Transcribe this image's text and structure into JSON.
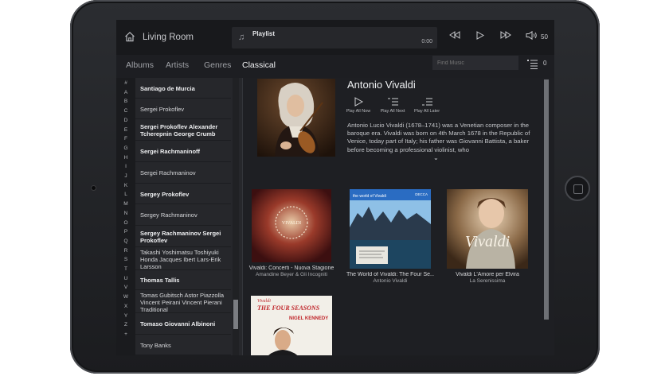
{
  "topbar": {
    "room": "Living Room",
    "now_playing_title": "Playlist",
    "note_glyph": "♫",
    "time": "0:00",
    "volume": "50"
  },
  "tabs": [
    "Albums",
    "Artists",
    "Genres",
    "Classical"
  ],
  "active_tab": "Classical",
  "search": {
    "placeholder": "Find Music"
  },
  "queue_count": "0",
  "alphabet": [
    "#",
    "A",
    "B",
    "C",
    "D",
    "E",
    "F",
    "G",
    "H",
    "I",
    "J",
    "K",
    "L",
    "M",
    "N",
    "O",
    "P",
    "Q",
    "R",
    "S",
    "T",
    "U",
    "V",
    "W",
    "X",
    "Y",
    "Z",
    "+"
  ],
  "artists": [
    {
      "name": "Santiago de Murcia",
      "bold": true
    },
    {
      "name": "Sergei Prokoflev",
      "bold": false
    },
    {
      "name": "Sergei Prokoflev Alexander Tcherepnin George Crumb",
      "bold": true
    },
    {
      "name": "Sergei Rachmaninoff",
      "bold": true
    },
    {
      "name": "Sergei Rachmaninov",
      "bold": false
    },
    {
      "name": "Sergey Prokoflev",
      "bold": true
    },
    {
      "name": "Sergey Rachmaninov",
      "bold": false
    },
    {
      "name": "Sergey Rachmaninov Sergei Prokoflev",
      "bold": true
    },
    {
      "name": "Takashi Yoshimatsu Toshiyuki Honda Jacques Ibert Lars-Erik Larsson",
      "bold": false
    },
    {
      "name": "Thomas Tallis",
      "bold": true
    },
    {
      "name": "Tomas Gubitsch Astor Piazzolla Vincent Peirani Vincent Pierani Traditional",
      "bold": false
    },
    {
      "name": "Tomaso Giovanni Albinoni",
      "bold": true
    },
    {
      "name": "Tony Banks",
      "bold": false
    }
  ],
  "detail": {
    "artist_name": "Antonio Vivaldi",
    "actions": [
      "Play All Now",
      "Play All Next",
      "Play All Later"
    ],
    "bio": "Antonio Lucio Vivaldi (1678–1741) was a Venetian composer in the baroque era. Vivaldi was born on 4th March 1678 in the Republic of Venice, today part of Italy; his father was Giovanni Battista, a baker before becoming a professional violinist, who",
    "expand_glyph": "⌄"
  },
  "albums": [
    {
      "title": "Vivaldi: Concerti - Nuova Stagione",
      "artist": "Amandine Beyer & Gli Incogniti"
    },
    {
      "title": "The World of Vivaldi: The Four Se...",
      "artist": "Antonio Vivaldi"
    },
    {
      "title": "Vivaldi L'Amore per Elvira",
      "artist": "La Serenissima"
    },
    {
      "title": "",
      "artist": ""
    }
  ],
  "album_art_text": {
    "a1_line1": "VIVALDI",
    "a2_label": "the world of Vivaldi",
    "a2_brand": "DECCA",
    "a3_script": "Vivaldi",
    "a4_line1": "Vivaldi",
    "a4_line2": "THE FOUR SEASONS",
    "a4_line3": "NIGEL KENNEDY"
  },
  "colors": {
    "screen_bg": "#1d1e22",
    "panel_bg": "#26272b",
    "text": "#cfd0d3",
    "accent_red": "#c0262b"
  }
}
